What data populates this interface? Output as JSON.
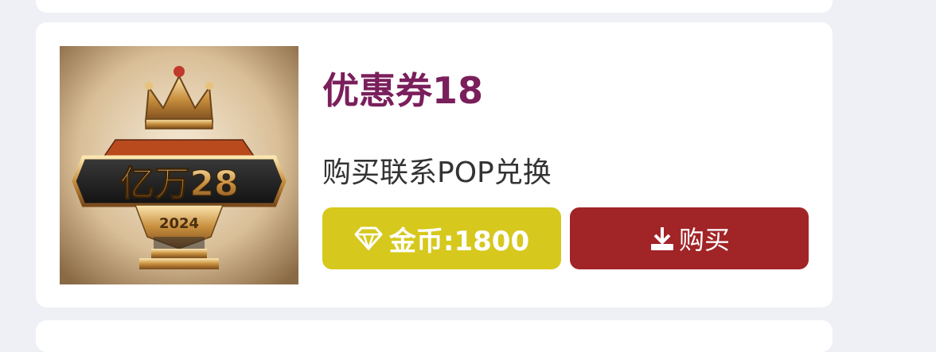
{
  "product": {
    "title": "优惠券18",
    "description": "购买联系POP兑换",
    "image_logo_text": "亿万28",
    "image_year_text": "2024",
    "price_label": "金币:1800",
    "price_icon": "diamond-icon",
    "buy_label": "购买",
    "buy_icon": "download-icon"
  },
  "colors": {
    "title": "#7a1f5c",
    "price_button": "#d6c81d",
    "buy_button": "#a12427",
    "page_background": "#eef0f5"
  }
}
